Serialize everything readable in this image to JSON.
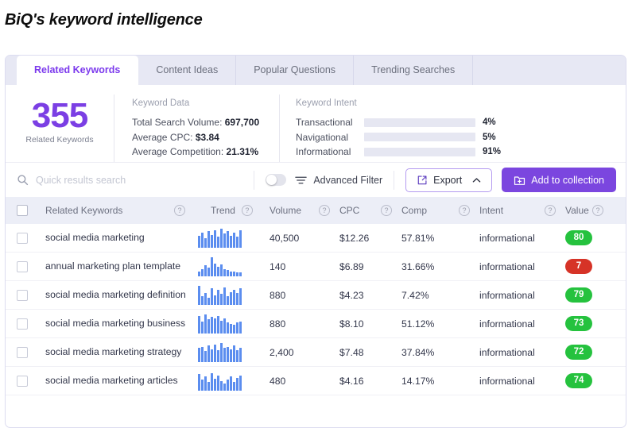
{
  "page_title": "BiQ's keyword intelligence",
  "tabs": [
    {
      "label": "Related Keywords",
      "active": true
    },
    {
      "label": "Content Ideas",
      "active": false
    },
    {
      "label": "Popular Questions",
      "active": false
    },
    {
      "label": "Trending Searches",
      "active": false
    }
  ],
  "summary": {
    "count": "355",
    "count_caption": "Related Keywords",
    "keyword_data": {
      "heading": "Keyword Data",
      "rows": [
        {
          "label": "Total Search Volume:",
          "value": "697,700"
        },
        {
          "label": "Average CPC:",
          "value": "$3.84"
        },
        {
          "label": "Average Competition:",
          "value": "21.31%"
        }
      ]
    },
    "keyword_intent": {
      "heading": "Keyword Intent",
      "rows": [
        {
          "label": "Transactional",
          "pct": "4%",
          "value": 4,
          "color": "#e03c31"
        },
        {
          "label": "Navigational",
          "pct": "5%",
          "value": 5,
          "color": "#fbb315"
        },
        {
          "label": "Informational",
          "pct": "91%",
          "value": 91,
          "color": "#27c93f"
        }
      ]
    }
  },
  "toolbar": {
    "search_placeholder": "Quick results search",
    "search_value": "",
    "advanced_filter_label": "Advanced Filter",
    "toggle_on": false,
    "export_label": "Export",
    "add_to_collection_label": "Add to collection"
  },
  "table": {
    "columns": [
      {
        "key": "keyword",
        "label": "Related Keywords",
        "help": true
      },
      {
        "key": "trend",
        "label": "Trend",
        "help": true
      },
      {
        "key": "volume",
        "label": "Volume",
        "help": true
      },
      {
        "key": "cpc",
        "label": "CPC",
        "help": true
      },
      {
        "key": "comp",
        "label": "Comp",
        "help": true
      },
      {
        "key": "intent",
        "label": "Intent",
        "help": true
      },
      {
        "key": "value",
        "label": "Value",
        "help": true
      }
    ],
    "rows": [
      {
        "keyword": "social media marketing",
        "trend": [
          10,
          13,
          8,
          14,
          11,
          15,
          9,
          16,
          12,
          14,
          10,
          13,
          9,
          15
        ],
        "volume": "40,500",
        "cpc": "$12.26",
        "comp": "57.81%",
        "intent": "informational",
        "value": "80",
        "value_color": "#25c23e"
      },
      {
        "keyword": "annual marketing plan template",
        "trend": [
          4,
          6,
          9,
          7,
          16,
          11,
          8,
          10,
          6,
          5,
          4,
          4,
          3,
          3
        ],
        "volume": "140",
        "cpc": "$6.89",
        "comp": "31.66%",
        "intent": "informational",
        "value": "7",
        "value_color": "#d63327"
      },
      {
        "keyword": "social media marketing definition",
        "trend": [
          16,
          7,
          10,
          6,
          14,
          8,
          13,
          9,
          15,
          7,
          11,
          13,
          10,
          14
        ],
        "volume": "880",
        "cpc": "$4.23",
        "comp": "7.42%",
        "intent": "informational",
        "value": "79",
        "value_color": "#25c23e"
      },
      {
        "keyword": "social media marketing business",
        "trend": [
          15,
          10,
          16,
          12,
          14,
          13,
          15,
          11,
          13,
          9,
          8,
          7,
          9,
          10
        ],
        "volume": "880",
        "cpc": "$8.10",
        "comp": "51.12%",
        "intent": "informational",
        "value": "73",
        "value_color": "#25c23e"
      },
      {
        "keyword": "social media marketing strategy",
        "trend": [
          12,
          13,
          9,
          14,
          11,
          15,
          10,
          16,
          12,
          13,
          11,
          14,
          10,
          12
        ],
        "volume": "2,400",
        "cpc": "$7.48",
        "comp": "37.84%",
        "intent": "informational",
        "value": "72",
        "value_color": "#25c23e"
      },
      {
        "keyword": "social media marketing articles",
        "trend": [
          14,
          9,
          12,
          7,
          15,
          10,
          13,
          8,
          6,
          9,
          12,
          7,
          11,
          13
        ],
        "volume": "480",
        "cpc": "$4.16",
        "comp": "14.17%",
        "intent": "informational",
        "value": "74",
        "value_color": "#25c23e"
      }
    ]
  },
  "icons": {
    "search": "search-icon",
    "filter": "filter-icon",
    "export": "export-icon",
    "folder_add": "folder-add-icon",
    "chevron_up": "chevron-up-icon",
    "help": "?"
  }
}
